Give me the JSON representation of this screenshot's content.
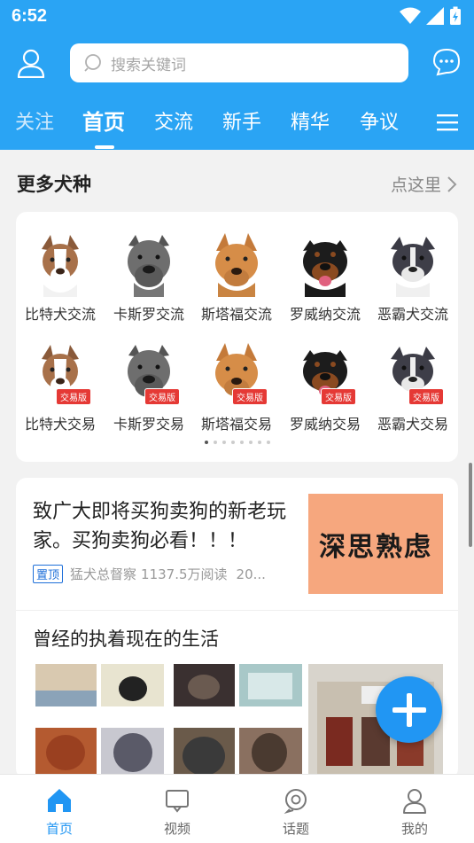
{
  "status": {
    "time": "6:52"
  },
  "header": {
    "search_placeholder": "搜索关键词",
    "tabs": [
      {
        "label": "关注"
      },
      {
        "label": "首页"
      },
      {
        "label": "交流"
      },
      {
        "label": "新手"
      },
      {
        "label": "精华"
      },
      {
        "label": "争议"
      }
    ]
  },
  "section": {
    "title": "更多犬种",
    "more": "点这里"
  },
  "breeds": {
    "row1": [
      {
        "label": "比特犬交流"
      },
      {
        "label": "卡斯罗交流"
      },
      {
        "label": "斯塔福交流"
      },
      {
        "label": "罗威纳交流"
      },
      {
        "label": "恶霸犬交流"
      }
    ],
    "row2": [
      {
        "label": "比特犬交易"
      },
      {
        "label": "卡斯罗交易"
      },
      {
        "label": "斯塔福交易"
      },
      {
        "label": "罗威纳交易"
      },
      {
        "label": "恶霸犬交易"
      }
    ],
    "trade_tag": "交易版"
  },
  "feed": {
    "post1": {
      "title": "致广大即将买狗卖狗的新老玩家。买狗卖狗必看！！！",
      "pin": "置顶",
      "author": "猛犬总督察",
      "reads": "1137.5万阅读",
      "date": "20...",
      "image_text": "深思熟虑"
    },
    "post2": {
      "title": "曾经的执着现在的生活"
    }
  },
  "bottom_nav": [
    {
      "label": "首页"
    },
    {
      "label": "视频"
    },
    {
      "label": "话题"
    },
    {
      "label": "我的"
    }
  ],
  "colors": {
    "brand_blue": "#2aa4f4",
    "accent_blue": "#2196f3",
    "tag_red": "#e53935"
  }
}
